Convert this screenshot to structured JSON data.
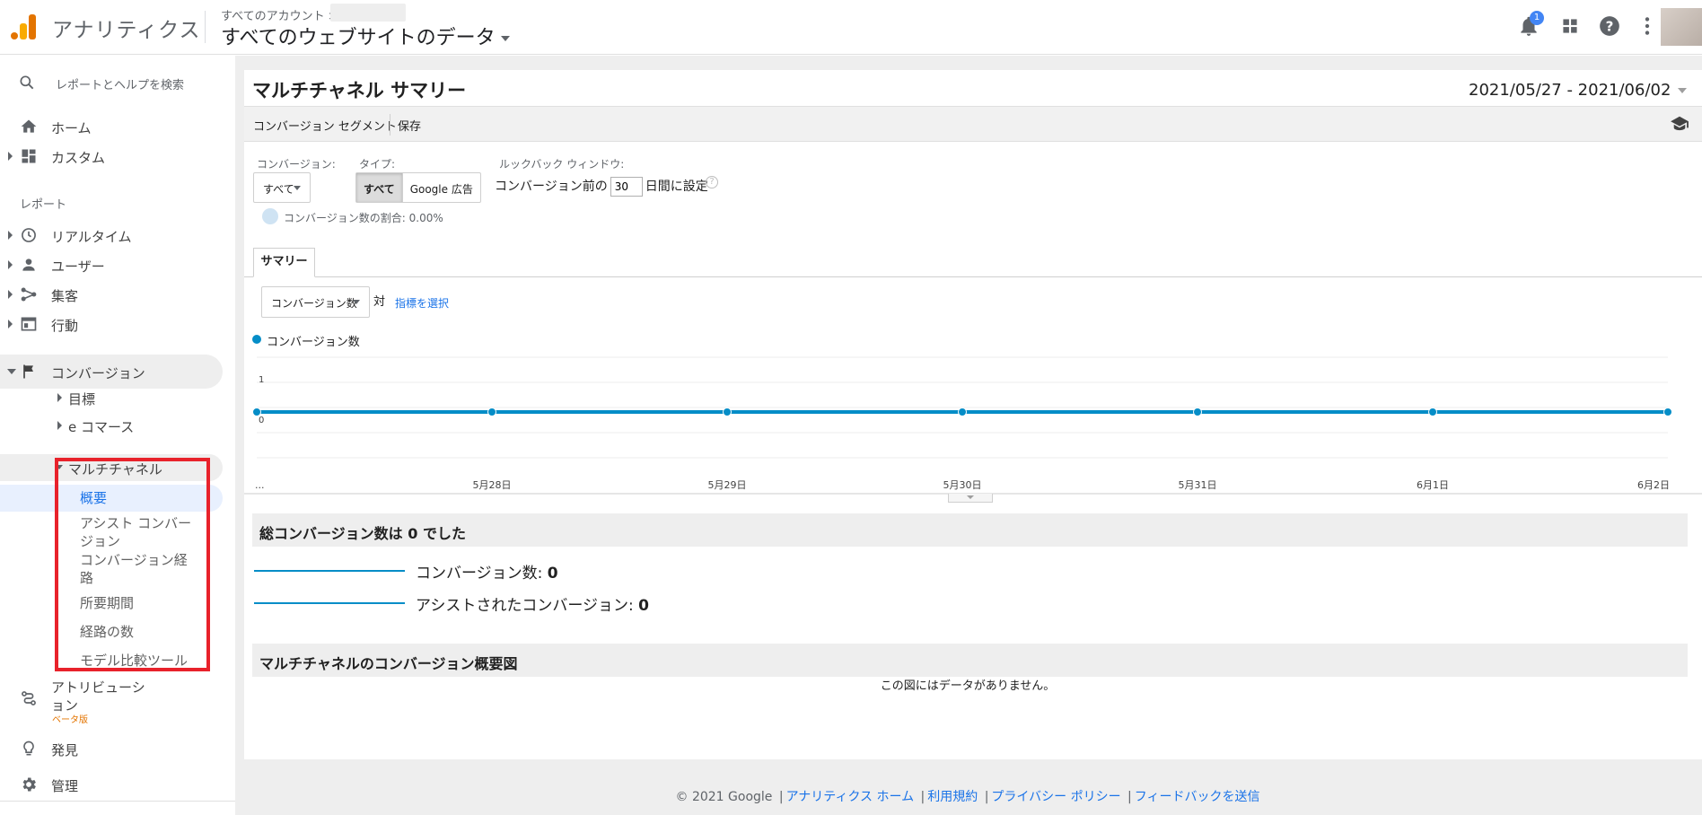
{
  "header": {
    "app_name": "アナリティクス",
    "breadcrumb": "すべてのアカウント >",
    "property": "すべてのウェブサイトのデータ",
    "notification_count": "1"
  },
  "sidebar": {
    "search_placeholder": "レポートとヘルプを検索",
    "home": "ホーム",
    "custom": "カスタム",
    "reports_label": "レポート",
    "realtime": "リアルタイム",
    "users": "ユーザー",
    "acquisition": "集客",
    "behavior": "行動",
    "conversions": "コンバージョン",
    "goals": "目標",
    "ecommerce": "e コマース",
    "multichannel": "マルチチャネル",
    "overview": "概要",
    "assisted": "アシスト コンバージョン",
    "paths": "コンバージョン経路",
    "time_lag": "所要期間",
    "path_length": "経路の数",
    "model_compare": "モデル比較ツール",
    "attribution": "アトリビューション",
    "beta": "ベータ版",
    "discover": "発見",
    "admin": "管理"
  },
  "main": {
    "title": "マルチチャネル サマリー",
    "date_range": "2021/05/27 - 2021/06/02",
    "segment_label": "コンバージョン セグメント",
    "save_label": "保存",
    "conversion_label": "コンバージョン:",
    "conversion_value": "すべて",
    "type_label": "タイプ:",
    "type_all": "すべて",
    "type_google_ads": "Google 広告",
    "lookback_label": "ルックバック ウィンドウ:",
    "lookback_prefix": "コンバージョン前の",
    "lookback_days": "30",
    "lookback_suffix": "日間に設定",
    "help_mark": "?",
    "ratio_text": "コンバージョン数の割合: 0.00%",
    "tab_summary": "サマリー",
    "metric_select": "コンバージョン数",
    "vs_label": "対",
    "pick_metric": "指標を選択",
    "total_heading": "総コンバージョン数は 0 でした",
    "conv_count_label": "コンバージョン数:",
    "conv_count_value": "0",
    "assisted_label": "アシストされたコンバージョン:",
    "assisted_value": "0",
    "overview_heading": "マルチチャネルのコンバージョン概要図",
    "no_data": "この図にはデータがありません。"
  },
  "chart_data": {
    "type": "line",
    "legend": "コンバージョン数",
    "x": [
      "...",
      "5月28日",
      "5月29日",
      "5月30日",
      "5月31日",
      "6月1日",
      "6月2日"
    ],
    "series": [
      {
        "name": "コンバージョン数",
        "values": [
          0,
          0,
          0,
          0,
          0,
          0,
          0
        ]
      }
    ],
    "y_ticks": [
      "1",
      "0"
    ],
    "ylim": [
      0,
      1
    ],
    "color": "#058dc7",
    "grid": true
  },
  "footer": {
    "copyright": "© 2021 Google",
    "links": [
      "アナリティクス ホーム",
      "利用規約",
      "プライバシー ポリシー",
      "フィードバックを送信"
    ]
  }
}
